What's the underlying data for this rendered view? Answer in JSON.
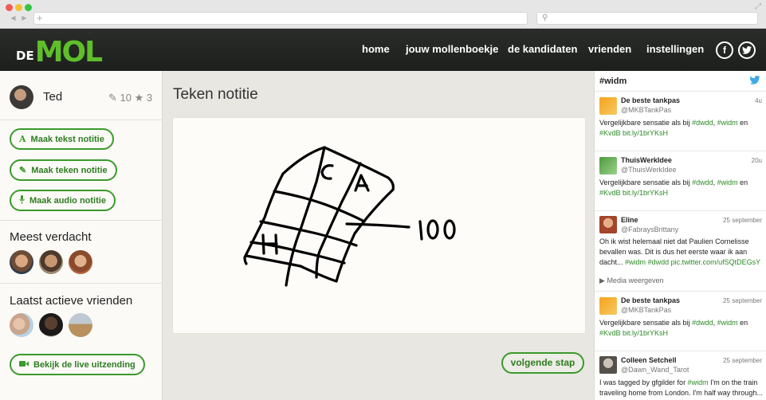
{
  "browser": {
    "back_icon": "arrow-left-icon",
    "forward_icon": "arrow-right-icon",
    "new_tab_icon": "plus-icon",
    "search_icon": "magnifier-icon",
    "expand_icon": "expand-icon"
  },
  "logo": {
    "de": "DE",
    "mol": "MOL"
  },
  "nav": {
    "home": "home",
    "mollenboekje": "jouw mollenboekje",
    "kandidaten": "de kandidaten",
    "vrienden": "vrienden",
    "instellingen": "instellingen",
    "facebook": "f",
    "twitter_icon": "twitter-bird-icon"
  },
  "profile": {
    "name": "Ted",
    "notes_count": "10",
    "stars_count": "3"
  },
  "actions": {
    "text_note": "Maak tekst notitie",
    "draw_note": "Maak teken notitie",
    "audio_note": "Maak audio notitie",
    "live": "Bekijk de live uitzending"
  },
  "sections": {
    "suspected": "Meest verdacht",
    "friends": "Laatst actieve vrienden"
  },
  "main": {
    "title": "Teken notitie",
    "drawing_labels": [
      "C",
      "A",
      "H",
      "100"
    ],
    "next_button": "volgende stap"
  },
  "twitter": {
    "hashtag": "#widm",
    "tweets": [
      {
        "name": "De beste tankpas",
        "handle": "@MKBTankPas",
        "time": "4u",
        "text_before": "Vergelijkbare sensatie als bij ",
        "tags": [
          "#dwdd",
          "#widm",
          "#KvdB bit.ly/1brYKsH"
        ],
        "text_mid": " en "
      },
      {
        "name": "ThuisWerkIdee",
        "handle": "@ThuisWerkIdee",
        "time": "20u",
        "text_before": "Vergelijkbare sensatie als bij ",
        "tags": [
          "#dwdd",
          "#widm",
          "#KvdB bit.ly/1brYKsH"
        ],
        "text_mid": " en "
      },
      {
        "name": "Eline",
        "handle": "@FabraysBrittany",
        "time": "25 september",
        "text": "Oh ik wist helemaal niet dat Paulien Cornelisse bevallen was. Dit is dus het eerste waar ik aan dacht... ",
        "tags": [
          "#widm",
          "#dwdd",
          "pic.twitter.com/ufSQtDEGsY"
        ],
        "media": "Media weergeven"
      },
      {
        "name": "De beste tankpas",
        "handle": "@MKBTankPas",
        "time": "25 september",
        "text_before": "Vergelijkbare sensatie als bij ",
        "tags": [
          "#dwdd",
          "#widm",
          "#KvdB bit.ly/1brYKsH"
        ],
        "text_mid": " en "
      },
      {
        "name": "Colleen Setchell",
        "handle": "@Dawn_Wand_Tarot",
        "time": "25 september",
        "text": "I was tagged by gfgilder for ",
        "tags": [
          "#widm"
        ],
        "text_after": " I'm on the train traveling home from London. I'm half way through... instagram.com/p/..."
      }
    ]
  },
  "colors": {
    "accent": "#3a9a2b",
    "header": "#262826",
    "logo_green": "#5fbf2a"
  }
}
